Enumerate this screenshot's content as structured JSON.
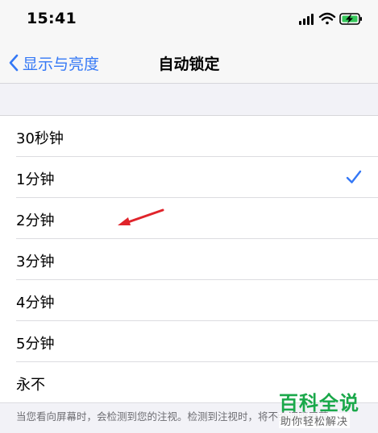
{
  "status_bar": {
    "time": "15:41"
  },
  "nav": {
    "back_label": "显示与亮度",
    "title": "自动锁定"
  },
  "options": [
    {
      "label": "30秒钟",
      "selected": false
    },
    {
      "label": "1分钟",
      "selected": true
    },
    {
      "label": "2分钟",
      "selected": false
    },
    {
      "label": "3分钟",
      "selected": false
    },
    {
      "label": "4分钟",
      "selected": false
    },
    {
      "label": "5分钟",
      "selected": false
    },
    {
      "label": "永不",
      "selected": false
    }
  ],
  "footer": {
    "text": "当您看向屏幕时，会检测到您的注视。检测到注视时，将不会调暗屏幕。"
  },
  "watermark": {
    "title": "百科全说",
    "subtitle": "助你轻松解决"
  },
  "colors": {
    "accent": "#3478f6",
    "annotation_arrow": "#e0242b",
    "watermark_green": "#1aa84a"
  }
}
